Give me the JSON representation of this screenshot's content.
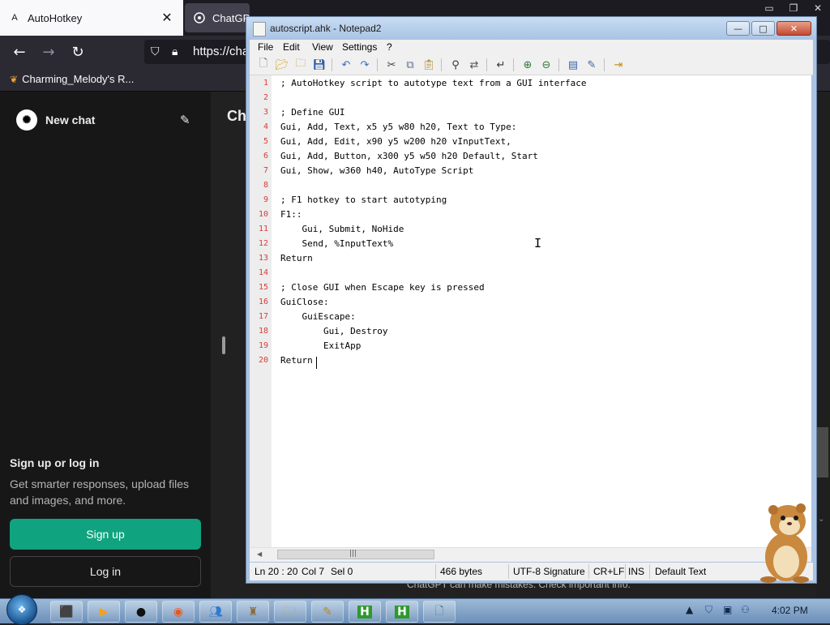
{
  "browser": {
    "tabs": [
      {
        "title": "AutoHotkey",
        "icon": "A",
        "active": true,
        "close": "✕"
      },
      {
        "title": "ChatGPT",
        "icon": "chatgpt-icon",
        "active": false
      }
    ],
    "url": "https://cha",
    "bookmark": "Charming_Melody's R...",
    "sidebar": {
      "new_chat": "New chat",
      "signup_heading": "Sign up or log in",
      "signup_sub": "Get smarter responses, upload files and images, and more.",
      "signup_button": "Sign up",
      "login_button": "Log in"
    },
    "main": {
      "title": "Ch",
      "footnote": "ChatGPT can make mistakes. Check important info."
    }
  },
  "notepad": {
    "title": "autoscript.ahk - Notepad2",
    "window_buttons": {
      "min": "—",
      "max": "□",
      "close": "✕"
    },
    "menu": [
      "File",
      "Edit",
      "View",
      "Settings",
      "?"
    ],
    "lines": [
      {
        "n": "1",
        "text": "; AutoHotkey script to autotype text from a GUI interface"
      },
      {
        "n": "2",
        "text": ""
      },
      {
        "n": "3",
        "text": "; Define GUI"
      },
      {
        "n": "4",
        "text": "Gui, Add, Text, x5 y5 w80 h20, Text to Type:"
      },
      {
        "n": "5",
        "text": "Gui, Add, Edit, x90 y5 w200 h20 vInputText,"
      },
      {
        "n": "6",
        "text": "Gui, Add, Button, x300 y5 w50 h20 Default, Start"
      },
      {
        "n": "7",
        "text": "Gui, Show, w360 h40, AutoType Script"
      },
      {
        "n": "8",
        "text": ""
      },
      {
        "n": "9",
        "text": "; F1 hotkey to start autotyping"
      },
      {
        "n": "10",
        "text": "F1::"
      },
      {
        "n": "11",
        "text": "    Gui, Submit, NoHide"
      },
      {
        "n": "12",
        "text": "    Send, %InputText%"
      },
      {
        "n": "13",
        "text": "Return"
      },
      {
        "n": "14",
        "text": ""
      },
      {
        "n": "15",
        "text": "; Close GUI when Escape key is pressed"
      },
      {
        "n": "16",
        "text": "GuiClose:"
      },
      {
        "n": "17",
        "text": "    GuiEscape:"
      },
      {
        "n": "18",
        "text": "        Gui, Destroy"
      },
      {
        "n": "19",
        "text": "        ExitApp"
      },
      {
        "n": "20",
        "text": "Return"
      }
    ],
    "status": {
      "position": "Ln 20 : 20",
      "col": "Col 7",
      "sel": "Sel 0",
      "size": "466 bytes",
      "encoding": "UTF-8 Signature",
      "eol": "CR+LF",
      "mode": "INS",
      "scheme": "Default Text"
    }
  },
  "taskbar": {
    "clock": "4:02 PM"
  },
  "colors": {
    "accent_green": "#10a37f",
    "line_number_red": "#d93b3b",
    "notepad_frame": "#aac3e3"
  }
}
